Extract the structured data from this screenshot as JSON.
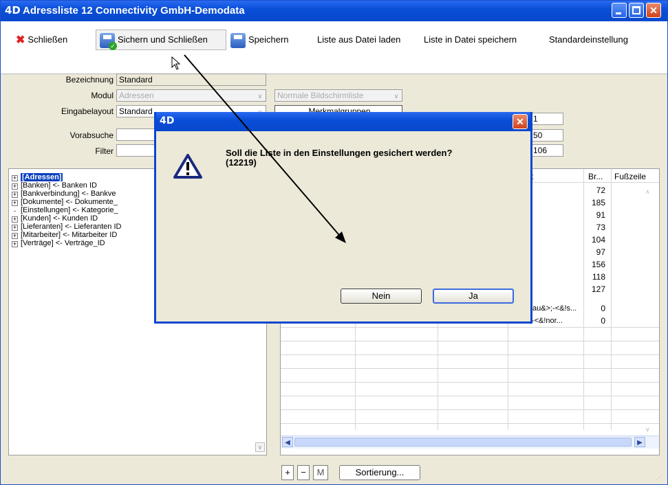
{
  "window": {
    "logo": "4D",
    "title": "Adressliste 12   Connectivity GmbH-Demodata"
  },
  "toolbar": {
    "close_label": "Schließen",
    "save_close_label": "Sichern und Schließen",
    "save_label": "Speichern",
    "load_label": "Liste aus Datei laden",
    "store_label": "Liste in Datei speichern",
    "default_label": "Standardeinstellung"
  },
  "form": {
    "bezeichnung_label": "Bezeichnung",
    "bezeichnung_value": "Standard",
    "modul_label": "Modul",
    "modul_value": "Adressen",
    "listtype_value": "Normale Bildschirmliste",
    "layout_label": "Eingabelayout",
    "layout_value": "Standard",
    "merkmal_label": "Merkmalgruppen",
    "vorabsuche_label": "Vorabsuche",
    "filter_label": "Filter",
    "num1": "1",
    "num2": "50",
    "num3": "106"
  },
  "tree": [
    {
      "label": "[Adressen]",
      "pm": "+",
      "selected": true
    },
    {
      "label": "[Banken] <- Banken ID",
      "pm": "+"
    },
    {
      "label": "[Bankverbindung] <- Bankve",
      "pm": "+"
    },
    {
      "label": "[Dokumente] <- Dokumente_",
      "pm": "+"
    },
    {
      "label": "[Einstellungen] <- Kategorie_",
      "pm": "-"
    },
    {
      "label": "[Kunden] <- Kunden ID",
      "pm": "+"
    },
    {
      "label": "[Lieferanten] <- Lieferanten ID",
      "pm": "+"
    },
    {
      "label": "[Mitarbeiter] <- Mitarbeiter ID",
      "pm": "+"
    },
    {
      "label": "[Verträge] <- Verträge_ID",
      "pm": "+"
    }
  ],
  "grid": {
    "col_t": "t",
    "col_br": "Br...",
    "col_fuss": "Fußzeile",
    "widths": [
      "72",
      "185",
      "91",
      "73",
      "104",
      "97",
      "156",
      "118",
      "127",
      "0",
      "0"
    ],
    "cell_a": "au&>;-<&!s...",
    "cell_b": "tt&>;-<&!nor..."
  },
  "bottom": {
    "plus": "+",
    "minus": "−",
    "m": "M",
    "sort_label": "Sortierung..."
  },
  "dialog": {
    "logo": "4D",
    "close": "✕",
    "message_line1": "Soll die Liste in den Einstellungen gesichert werden?",
    "message_line2": "(12219)",
    "no_label": "Nein",
    "yes_label": "Ja"
  },
  "colors": {
    "title_blue": "#0a4fd8",
    "selection_blue": "#0a3fbe",
    "window_bg": "#ece9d8"
  }
}
